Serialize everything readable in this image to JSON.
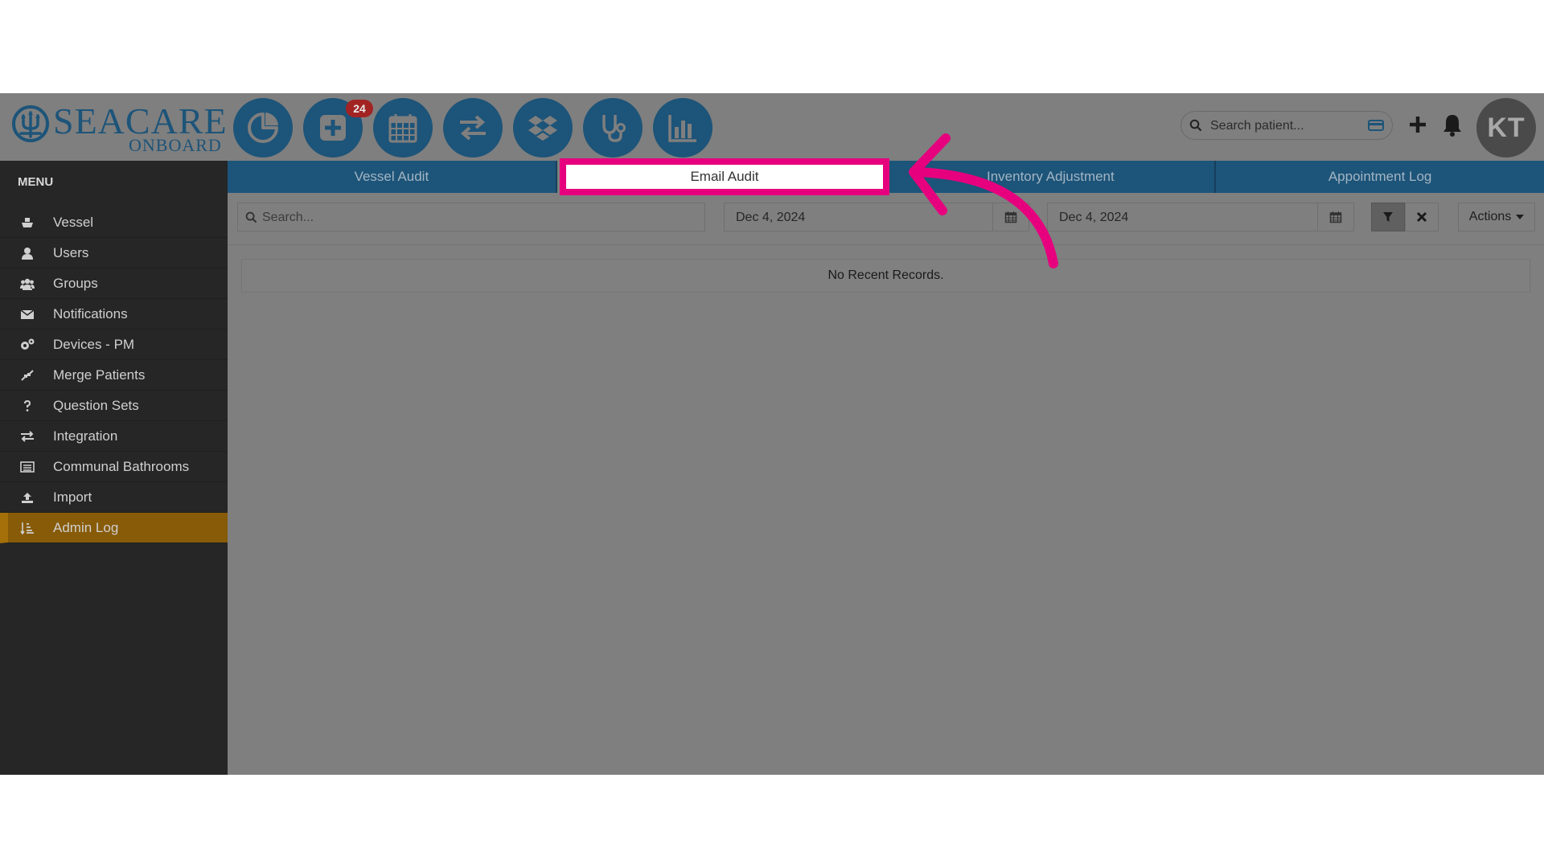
{
  "header": {
    "logo_main": "SEACARE",
    "logo_sub": "ONBOARD",
    "nav_icons": [
      "dashboard-pie-icon",
      "add-patient-icon",
      "calendar-icon",
      "transfer-icon",
      "dropbox-icon",
      "stethoscope-icon",
      "reports-chart-icon"
    ],
    "notification_badge": "24",
    "search_placeholder": "Search patient...",
    "avatar_initials": "KT"
  },
  "sidebar": {
    "title": "MENU",
    "items": [
      {
        "label": "Vessel",
        "icon": "ship-icon"
      },
      {
        "label": "Users",
        "icon": "user-icon"
      },
      {
        "label": "Groups",
        "icon": "group-icon"
      },
      {
        "label": "Notifications",
        "icon": "envelope-icon"
      },
      {
        "label": "Devices - PM",
        "icon": "gears-icon"
      },
      {
        "label": "Merge Patients",
        "icon": "merge-icon"
      },
      {
        "label": "Question Sets",
        "icon": "question-icon"
      },
      {
        "label": "Integration",
        "icon": "exchange-icon"
      },
      {
        "label": "Communal Bathrooms",
        "icon": "list-icon"
      },
      {
        "label": "Import",
        "icon": "upload-icon"
      },
      {
        "label": "Admin Log",
        "icon": "sort-log-icon",
        "active": true
      }
    ]
  },
  "tabs": [
    {
      "label": "Vessel Audit"
    },
    {
      "label": "Email Audit",
      "selected": true
    },
    {
      "label": "Inventory Adjustment"
    },
    {
      "label": "Appointment Log"
    }
  ],
  "filters": {
    "search_placeholder": "Search...",
    "date_from": "Dec 4, 2024",
    "date_to": "Dec 4, 2024",
    "actions_label": "Actions"
  },
  "records": {
    "empty_message": "No Recent Records."
  },
  "colors": {
    "highlight": "#e6007e",
    "nav_blue": "#1d5479",
    "active_menu": "#875b08"
  }
}
